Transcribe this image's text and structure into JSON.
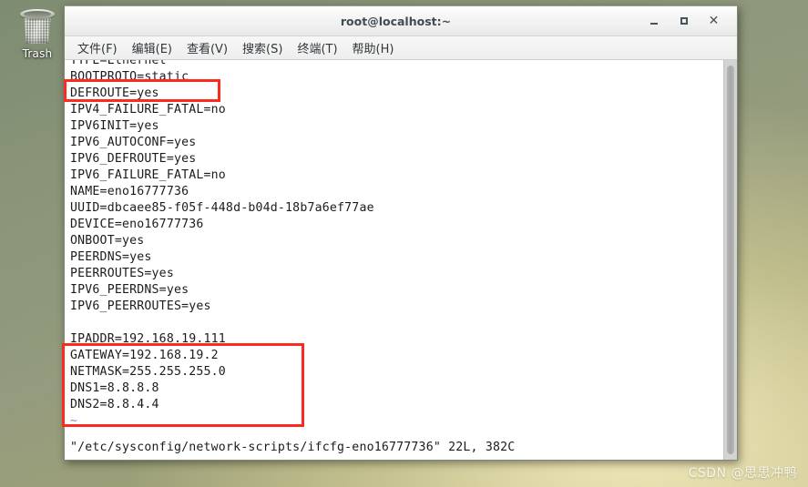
{
  "desktop": {
    "trash": {
      "label": "Trash",
      "icon": "trash-bin-icon"
    },
    "watermark": "CSDN @思思冲鸭"
  },
  "window": {
    "title": "root@localhost:~",
    "buttons": {
      "minimize": "minimize-button",
      "maximize": "maximize-button",
      "close": "close-button"
    }
  },
  "menubar": {
    "items": [
      {
        "label": "文件(F)",
        "name": "menu-file"
      },
      {
        "label": "编辑(E)",
        "name": "menu-edit"
      },
      {
        "label": "查看(V)",
        "name": "menu-view"
      },
      {
        "label": "搜索(S)",
        "name": "menu-search"
      },
      {
        "label": "终端(T)",
        "name": "menu-terminal"
      },
      {
        "label": "帮助(H)",
        "name": "menu-help"
      }
    ]
  },
  "terminal": {
    "lines": [
      "TYPE=Ethernet",
      "BOOTPROTO=static",
      "DEFROUTE=yes",
      "IPV4_FAILURE_FATAL=no",
      "IPV6INIT=yes",
      "IPV6_AUTOCONF=yes",
      "IPV6_DEFROUTE=yes",
      "IPV6_FAILURE_FATAL=no",
      "NAME=eno16777736",
      "UUID=dbcaee85-f05f-448d-b04d-18b7a6ef77ae",
      "DEVICE=eno16777736",
      "ONBOOT=yes",
      "PEERDNS=yes",
      "PEERROUTES=yes",
      "IPV6_PEERDNS=yes",
      "IPV6_PEERROUTES=yes",
      "",
      "IPADDR=192.168.19.111",
      "GATEWAY=192.168.19.2",
      "NETMASK=255.255.255.0",
      "DNS1=8.8.8.8",
      "DNS2=8.8.4.4",
      "~"
    ],
    "status_line": "\"/etc/sysconfig/network-scripts/ifcfg-eno16777736\" 22L, 382C"
  },
  "annotations": {
    "color": "#fc2b20",
    "boxes": [
      {
        "name": "highlight-bootproto",
        "target": "BOOTPROTO=static"
      },
      {
        "name": "highlight-ip-settings",
        "target": "IPADDR/GATEWAY/NETMASK/DNS1/DNS2"
      }
    ]
  }
}
